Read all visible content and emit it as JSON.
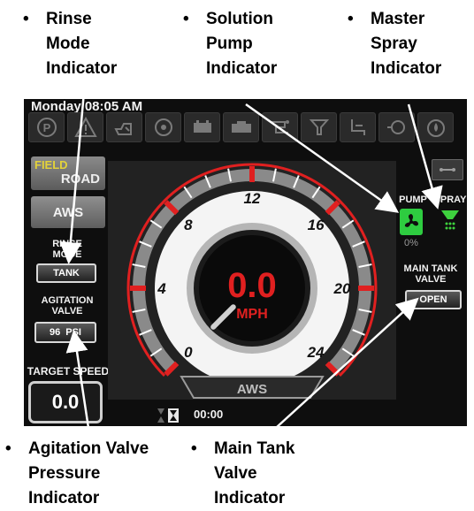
{
  "callouts": {
    "bullet": "•",
    "rinse": "Rinse\nMode\nIndicator",
    "solution": "Solution\nPump\nIndicator",
    "master": "Master\nSpray\nIndicator",
    "agitation": "Agitation Valve\nPressure\nIndicator",
    "main_tank": "Main Tank\nValve\nIndicator"
  },
  "screen": {
    "clock": "Monday 08:05 AM",
    "top_icons": [
      "parking-brake-icon",
      "warning-icon",
      "engine-oil-icon",
      "coolant-icon",
      "battery-icon",
      "alternator-icon",
      "hydraulic-icon",
      "filter-icon",
      "seat-icon",
      "fuel-icon",
      "droplet-icon"
    ],
    "field_label": "FIELD",
    "road_label": "ROAD",
    "aws_button": "AWS",
    "rinse_mode_label": "RINSE\nMODE",
    "rinse_mode_value": "TANK",
    "agitation_label": "AGITATION\nVALVE",
    "agitation_value": "96",
    "agitation_unit": "PSI",
    "target_speed_label": "TARGET SPEED",
    "target_speed_value": "0.0",
    "pump_label": "PUMP",
    "spray_label": "SPRAY",
    "pump_percent": "0%",
    "main_tank_label": "MAIN TANK\nVALVE",
    "main_tank_value": "OPEN",
    "timer": "00:00",
    "gauge": {
      "speed": "0.0",
      "unit": "MPH",
      "mode": "AWS",
      "ticks": [
        "0",
        "4",
        "8",
        "12",
        "16",
        "20",
        "24"
      ]
    }
  },
  "colors": {
    "accent_red": "#e02020",
    "pump_green": "#2ecc40",
    "spray_green": "#3ed23e",
    "field_yellow": "#e3d23a"
  }
}
